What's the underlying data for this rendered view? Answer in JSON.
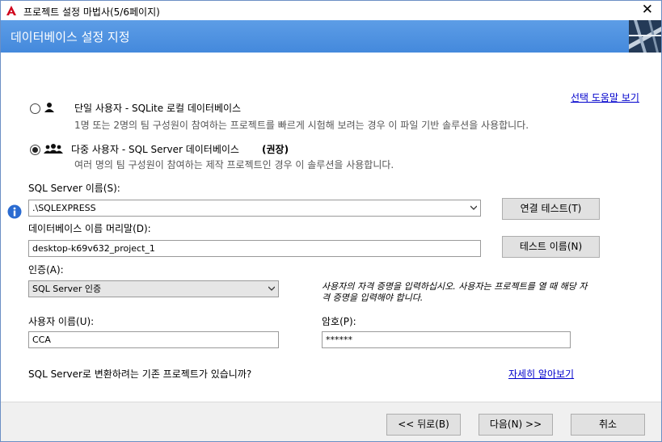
{
  "window": {
    "title": "프로젝트 설정 마법사(5/6페이지)"
  },
  "banner": {
    "title": "데이터베이스 설정 지정"
  },
  "help_link": "선택 도움말 보기",
  "options": {
    "single": {
      "label": "단일  사용자 - SQLite 로컬 데이터베이스",
      "description": "1명 또는 2명의 팀 구성원이 참여하는 프로젝트를 빠르게 시험해 보려는 경우 이 파일 기반 솔루션을 사용합니다."
    },
    "multi": {
      "label": "다중 사용자 - SQL Server 데이터베이스",
      "badge": "(권장)",
      "description": "여러 명의 팀 구성원이 참여하는 제작 프로젝트인 경우 이 솔루션을 사용합니다."
    }
  },
  "sql_server": {
    "label": "SQL Server 이름(S):",
    "value": ".\\SQLEXPRESS",
    "test_button": "연결 테스트(T)"
  },
  "db_prefix": {
    "label": "데이터베이스 이름 머리말(D):",
    "value": "desktop-k69v632_project_1",
    "test_button": "테스트 이름(N)"
  },
  "auth": {
    "label": "인증(A):",
    "value": "SQL Server 인증",
    "note": "사용자의 자격 증명을 입력하십시오. 사용자는 프로젝트를 열 때 해당 자격 증명을 입력해야 합니다."
  },
  "username": {
    "label": "사용자 이름(U):",
    "value": "CCA"
  },
  "password": {
    "label": "암호(P):",
    "value": "******"
  },
  "convert": {
    "question": "SQL Server로 변환하려는 기존 프로젝트가 있습니까?",
    "link": "자세히 알아보기"
  },
  "footer": {
    "back": "<< 뒤로(B)",
    "next": "다음(N) >>",
    "cancel": "취소"
  },
  "colors": {
    "banner": "#4a8fe0",
    "link": "#0000cc",
    "info": "#2a6bd1"
  }
}
